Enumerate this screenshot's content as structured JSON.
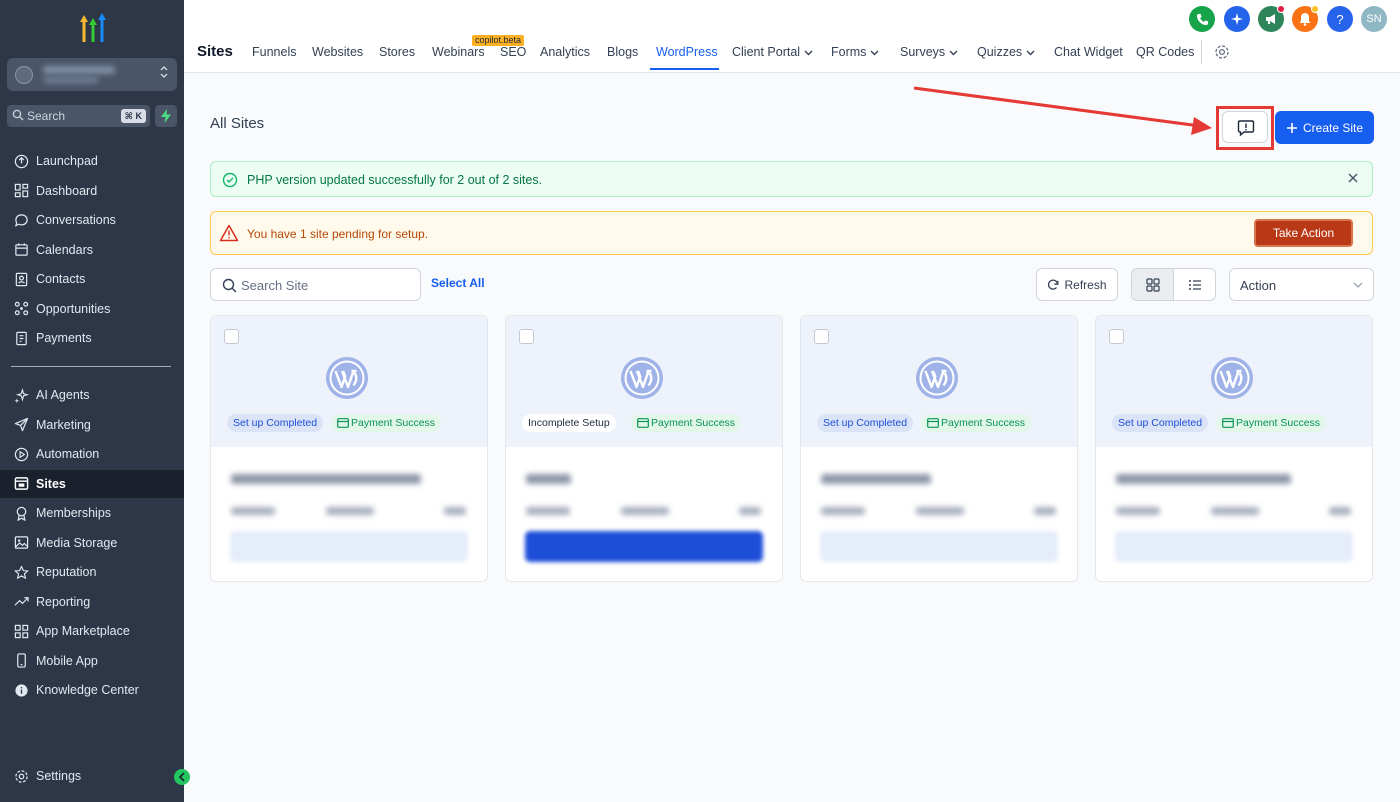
{
  "sidebar": {
    "search_placeholder": "Search",
    "search_shortcut": "⌘ K",
    "items_top": [
      {
        "label": "Launchpad",
        "icon": "launchpad-icon"
      },
      {
        "label": "Dashboard",
        "icon": "dashboard-icon"
      },
      {
        "label": "Conversations",
        "icon": "chat-bubble-icon"
      },
      {
        "label": "Calendars",
        "icon": "calendar-icon"
      },
      {
        "label": "Contacts",
        "icon": "contacts-icon"
      },
      {
        "label": "Opportunities",
        "icon": "opportunities-icon"
      },
      {
        "label": "Payments",
        "icon": "payments-icon"
      }
    ],
    "items_bottom": [
      {
        "label": "AI Agents",
        "icon": "ai-sparkle-icon"
      },
      {
        "label": "Marketing",
        "icon": "send-icon"
      },
      {
        "label": "Automation",
        "icon": "automation-icon"
      },
      {
        "label": "Sites",
        "icon": "sites-icon",
        "active": true
      },
      {
        "label": "Memberships",
        "icon": "membership-icon"
      },
      {
        "label": "Media Storage",
        "icon": "image-icon"
      },
      {
        "label": "Reputation",
        "icon": "star-icon"
      },
      {
        "label": "Reporting",
        "icon": "trend-icon"
      },
      {
        "label": "App Marketplace",
        "icon": "grid-icon"
      },
      {
        "label": "Mobile App",
        "icon": "mobile-icon"
      },
      {
        "label": "Knowledge Center",
        "icon": "info-icon"
      }
    ],
    "settings_label": "Settings"
  },
  "topbar": {
    "title": "Sites",
    "tabs": [
      {
        "label": "Funnels"
      },
      {
        "label": "Websites"
      },
      {
        "label": "Stores"
      },
      {
        "label": "Webinars"
      },
      {
        "label": "SEO"
      },
      {
        "label": "Analytics"
      },
      {
        "label": "Blogs"
      },
      {
        "label": "WordPress",
        "active": true
      },
      {
        "label": "Client Portal",
        "dropdown": true
      },
      {
        "label": "Forms",
        "dropdown": true
      },
      {
        "label": "Surveys",
        "dropdown": true
      },
      {
        "label": "Quizzes",
        "dropdown": true
      },
      {
        "label": "Chat Widget"
      },
      {
        "label": "QR Codes"
      }
    ],
    "beta_badge": "copilot.beta",
    "user_initials": "SN"
  },
  "main": {
    "page_title": "All Sites",
    "create_button": "Create Site",
    "success_alert": "PHP version updated successfully for 2 out of 2 sites.",
    "warning_alert": "You have 1 site pending for setup.",
    "take_action_button": "Take Action",
    "search_placeholder": "Search Site",
    "select_all": "Select All",
    "refresh_button": "Refresh",
    "action_select": "Action"
  },
  "cards": [
    {
      "status": "Set up Completed",
      "payment": "Payment Success"
    },
    {
      "status": "Incomplete Setup",
      "payment": "Payment Success"
    },
    {
      "status": "Set up Completed",
      "payment": "Payment Success"
    },
    {
      "status": "Set up Completed",
      "payment": "Payment Success"
    }
  ],
  "colors": {
    "sidebar_bg": "#2d3748",
    "accent": "#155eef",
    "success": "#067647",
    "warning": "#b54708",
    "highlight": "#e53935"
  }
}
